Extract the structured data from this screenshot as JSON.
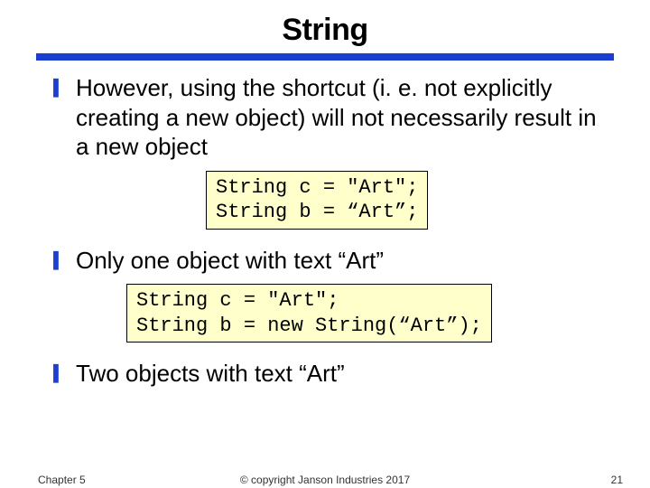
{
  "title": "String",
  "bullets": [
    "However, using the shortcut (i. e. not explicitly creating a new object) will not necessarily result in a new object",
    "Only one object with text “Art”",
    "Two objects with text “Art”"
  ],
  "code1": "String c = \"Art\";\nString b = “Art”;",
  "code2": "String c = \"Art\";\nString b = new String(“Art”);",
  "footer": {
    "left": "Chapter 5",
    "center": "© copyright Janson Industries 2017",
    "right": "21"
  }
}
